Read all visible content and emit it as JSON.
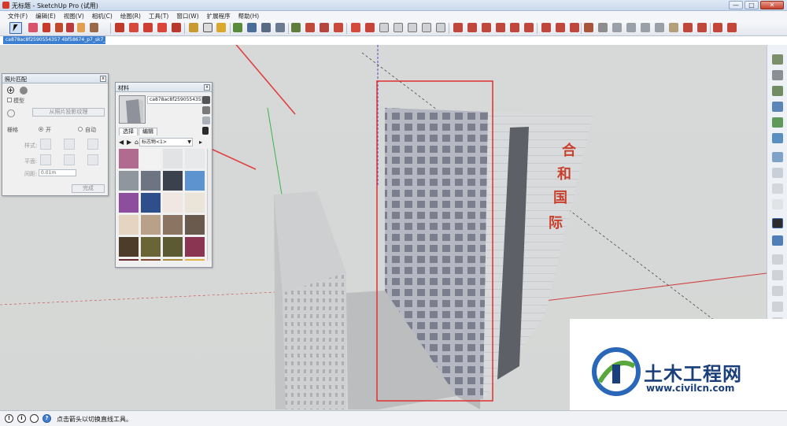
{
  "window": {
    "title": "无标题 - SketchUp Pro (试用)",
    "controls": [
      "—",
      "□",
      "✕"
    ]
  },
  "menu": [
    "文件(F)",
    "编辑(E)",
    "视图(V)",
    "相机(C)",
    "绘图(R)",
    "工具(T)",
    "窗口(W)",
    "扩展程序",
    "帮助(H)"
  ],
  "model_tab": "ca878ac8f2590554357 4bf58674_p7_sk7_ww47",
  "photo_match": {
    "title": "照片匹配",
    "model_label": "模型",
    "project_button": "从照片投影纹理",
    "grid_label": "栅格",
    "grid_on": "开",
    "grid_auto": "自动",
    "style_label": "样式:",
    "plane_label": "平面:",
    "spacing_label": "间距:",
    "spacing_value": "0.01m",
    "done_button": "完成"
  },
  "materials": {
    "title": "材料",
    "current_name": "ca878ac8f2590554357",
    "tab_select": "选择",
    "tab_edit": "编辑",
    "collection": "标志物<1>",
    "swatch_colors": [
      "#b06b8e",
      "#f2f2f2",
      "#e2e3e4",
      "#e8e9ea",
      "#8f969d",
      "#6e7582",
      "#3b414d",
      "#5d94cf",
      "#8e4e9e",
      "#2e4f8a",
      "#f1e7e2",
      "#ebe4d9",
      "#e5d4c2",
      "#b8a089",
      "#8c7462",
      "#6a5a4e",
      "#4e3c2a",
      "#6a6536",
      "#5c5a32",
      "#8a3552",
      "#6b2a2e",
      "#7e4a2d",
      "#a88a3c",
      "#e0b44a"
    ]
  },
  "building_sign": [
    "合",
    "和",
    "国",
    "际"
  ],
  "status": {
    "text": "点击箭头以切换直线工具。",
    "icons": [
      "!",
      "i",
      "?"
    ]
  },
  "watermark": {
    "title": "土木工程网",
    "url": "www.civilcn.com"
  }
}
